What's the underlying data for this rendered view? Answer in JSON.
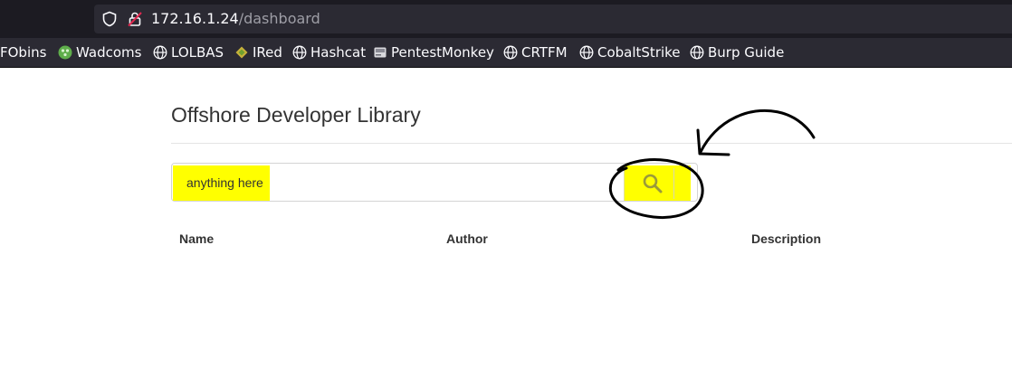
{
  "browser": {
    "url_host": "172.16.1.24",
    "url_path": "/dashboard",
    "bookmarks": [
      {
        "label": "FObins",
        "icon": "none"
      },
      {
        "label": "Wadcoms",
        "icon": "green-circle-icon"
      },
      {
        "label": "LOLBAS",
        "icon": "globe-icon"
      },
      {
        "label": "IRed",
        "icon": "diamond-icon"
      },
      {
        "label": "Hashcat",
        "icon": "globe-icon"
      },
      {
        "label": "PentestMonkey",
        "icon": "drive-icon"
      },
      {
        "label": "CRTFM",
        "icon": "globe-icon"
      },
      {
        "label": "CobaltStrike",
        "icon": "globe-icon"
      },
      {
        "label": "Burp Guide",
        "icon": "globe-icon"
      }
    ]
  },
  "page": {
    "title": "Offshore Developer Library",
    "search": {
      "value": "anything here",
      "placeholder": "",
      "button_icon": "search-icon"
    },
    "table": {
      "columns": [
        "Name",
        "Author",
        "Description"
      ]
    }
  },
  "colors": {
    "highlight": "#ffff00",
    "chrome_dark": "#1c1b22",
    "chrome_bar": "#2b2a33"
  }
}
